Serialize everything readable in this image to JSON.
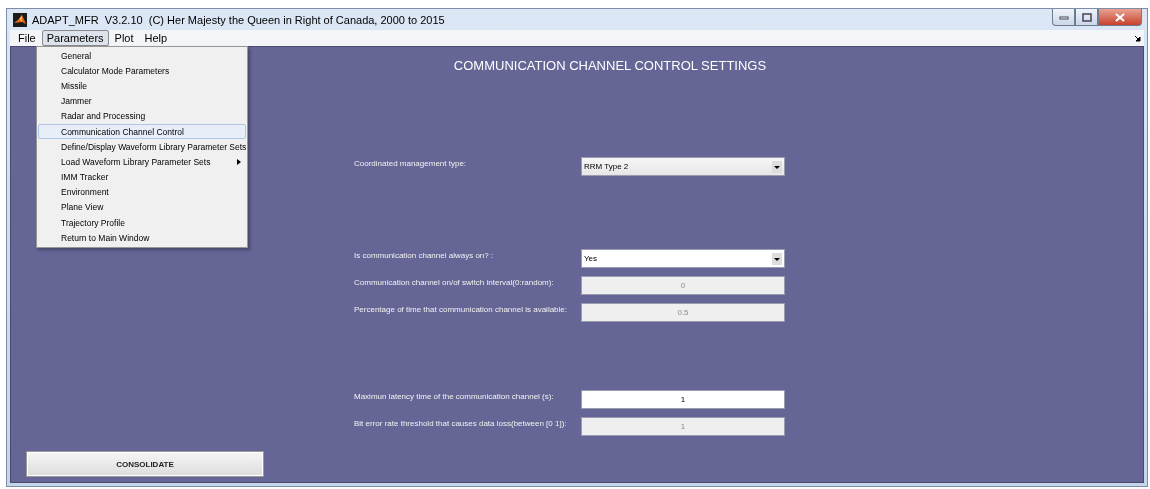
{
  "window": {
    "title": "ADAPT_MFR  V3.2.10  (C) Her Majesty the Queen in Right of Canada, 2000 to 2015"
  },
  "menu_bar": [
    {
      "label": "File",
      "selected": false
    },
    {
      "label": "Parameters",
      "selected": true
    },
    {
      "label": "Plot",
      "selected": false
    },
    {
      "label": "Help",
      "selected": false
    }
  ],
  "open_menu": {
    "items": [
      {
        "label": "General",
        "selected": false,
        "has_submenu": false
      },
      {
        "label": "Calculator Mode Parameters",
        "selected": false,
        "has_submenu": false
      },
      {
        "label": "Missile",
        "selected": false,
        "has_submenu": false
      },
      {
        "label": "Jammer",
        "selected": false,
        "has_submenu": false
      },
      {
        "label": "Radar and Processing",
        "selected": false,
        "has_submenu": false
      },
      {
        "label": "Communication Channel Control",
        "selected": true,
        "has_submenu": false
      },
      {
        "label": "Define/Display Waveform Library Parameter Sets",
        "selected": false,
        "has_submenu": false
      },
      {
        "label": "Load Waveform Library Parameter Sets",
        "selected": false,
        "has_submenu": true
      },
      {
        "label": "IMM Tracker",
        "selected": false,
        "has_submenu": false
      },
      {
        "label": "Environment",
        "selected": false,
        "has_submenu": false
      },
      {
        "label": "Plane View",
        "selected": false,
        "has_submenu": false
      },
      {
        "label": "Trajectory Profile",
        "selected": false,
        "has_submenu": false
      },
      {
        "label": "Return to Main Window",
        "selected": false,
        "has_submenu": false
      }
    ]
  },
  "heading": "COMMUNICATION CHANNEL CONTROL SETTINGS",
  "groups": [
    [
      {
        "label": "Coordinated management type:",
        "kind": "select",
        "value": "RRM Type 2",
        "disabled": false
      }
    ],
    [
      {
        "label": "Is communication channel always on? :",
        "kind": "select",
        "value": "Yes",
        "disabled": false
      },
      {
        "label": "Communication channel on/of switch interval(0:random):",
        "kind": "text",
        "value": "0",
        "disabled": true
      },
      {
        "label": "Percentage of time that communication channel is available:",
        "kind": "text",
        "value": "0.5",
        "disabled": true
      }
    ],
    [
      {
        "label": "Maximun latency time of the communication channel (s):",
        "kind": "text",
        "value": "1",
        "disabled": false
      },
      {
        "label": "Bit error rate threshold that causes data loss(between [0 1]):",
        "kind": "text",
        "value": "1",
        "disabled": true
      }
    ]
  ],
  "consolidate_button": "CONSOLIDATE"
}
